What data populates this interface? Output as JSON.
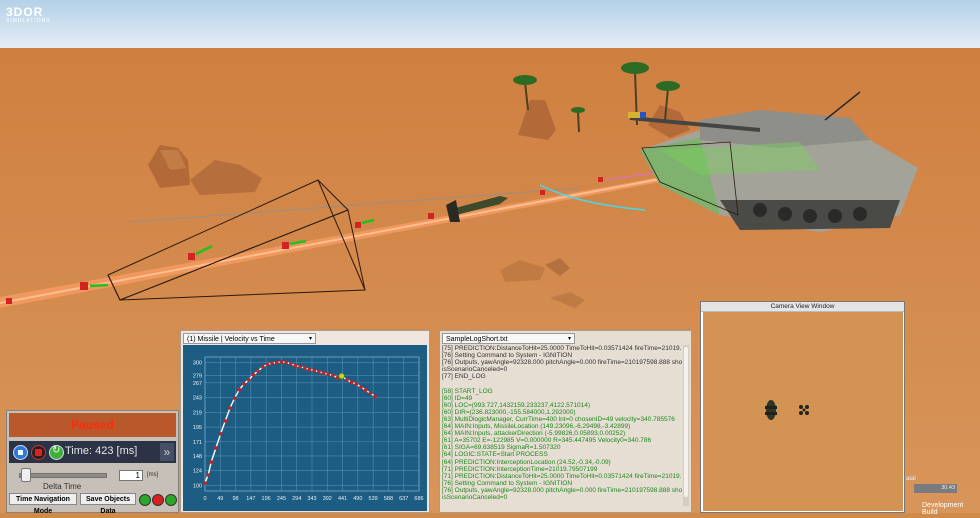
{
  "logo": {
    "name": "3DOR",
    "subtitle": "SIMULATIONS"
  },
  "playback": {
    "status": "Paused",
    "time_text": "Time: 423 [ms]",
    "fast_forward": "»",
    "delta_label": "Delta Time",
    "delta_value": "1",
    "delta_unit": "[ms]",
    "slider_fraction": 0.02,
    "time_nav_label": "Time Navigation Mode",
    "save_label": "Save Objects Data"
  },
  "graph": {
    "dropdown": "(1) Missile | Velocity vs Time",
    "dropdown_arrow": "▾"
  },
  "chart_data": {
    "type": "scatter",
    "title": "",
    "xlabel": "",
    "ylabel": "",
    "x_ticks": [
      0,
      49,
      98,
      147,
      196,
      245,
      294,
      343,
      392,
      441,
      490,
      539,
      588,
      637,
      686
    ],
    "y_ticks": [
      100,
      124,
      148,
      171,
      195,
      219,
      243,
      267,
      279,
      300
    ],
    "xlim": [
      0,
      686
    ],
    "ylim": [
      91,
      309
    ],
    "series": [
      {
        "color": "#c82020",
        "points": [
          [
            0,
            104
          ],
          [
            10,
            117
          ],
          [
            20,
            138
          ],
          [
            35,
            161
          ],
          [
            50,
            184
          ],
          [
            65,
            205
          ],
          [
            80,
            226
          ],
          [
            95,
            242
          ],
          [
            110,
            256
          ],
          [
            125,
            265
          ],
          [
            140,
            272
          ],
          [
            155,
            280
          ],
          [
            170,
            286
          ],
          [
            185,
            293
          ],
          [
            200,
            297
          ],
          [
            215,
            299
          ],
          [
            230,
            300
          ],
          [
            245,
            301
          ],
          [
            260,
            300
          ],
          [
            275,
            298
          ],
          [
            290,
            295
          ],
          [
            305,
            293
          ],
          [
            320,
            291
          ],
          [
            335,
            289
          ],
          [
            350,
            287
          ],
          [
            365,
            285
          ],
          [
            380,
            283
          ],
          [
            395,
            281
          ],
          [
            410,
            279
          ],
          [
            425,
            275
          ],
          [
            440,
            277
          ],
          [
            455,
            272
          ],
          [
            470,
            268
          ],
          [
            485,
            265
          ],
          [
            500,
            260
          ],
          [
            515,
            255
          ],
          [
            530,
            250
          ],
          [
            545,
            245
          ]
        ]
      }
    ],
    "highlight_point": [
      438,
      278
    ],
    "curve_color": "#ffffff",
    "grid": true
  },
  "log": {
    "dropdown": "SampleLogShort.txt",
    "dropdown_arrow": "▾",
    "lines": [
      {
        "t": "[75] PREDICTION:DistanceToHit=25.0000 TimeToHit=0.03571424 fireTime=21019.7592",
        "c": "#333"
      },
      {
        "t": "[76] Setting Command to System - IGNITION",
        "c": "#333"
      },
      {
        "t": "[76] Outputs, yawAngle=92328.000 pitchAngle=0.000 fireTime=210197598.888 shouldA",
        "c": "#333"
      },
      {
        "t": "isScenarioCanceled=0",
        "c": "#333"
      },
      {
        "t": "[77] END_LOG",
        "c": "#333"
      },
      {
        "t": "",
        "c": "#333"
      },
      {
        "t": "[58] START_LOG",
        "c": "#1e8a1e"
      },
      {
        "t": "[60] ID=49",
        "c": "#1e8a1e"
      },
      {
        "t": "[60] LOC=(993.727,1432159.233237,4122.571014)",
        "c": "#1e8a1e"
      },
      {
        "t": "[60] DIR=(236.823000,-155.584000,1.292000)",
        "c": "#1e8a1e"
      },
      {
        "t": "[63] MultiDlogicManager, CurrTime=400 lnt=0 chosenID=49 velocity=340.785576",
        "c": "#1e8a1e"
      },
      {
        "t": "[64] MAIN:Inputs, MissileLocation (149.23096,-6.29498,-3.42899)",
        "c": "#1e8a1e"
      },
      {
        "t": "[64] MAIN:Inputs, attackerDirection (-5.99826,0.05893,0.00252)",
        "c": "#1e8a1e"
      },
      {
        "t": "[61] A=35702 E=-122985 V=0.000000 R=345.447495 Velocity0=340.786",
        "c": "#1e8a1e"
      },
      {
        "t": "[61] SIGA=69.638519 SigmaR=1.507320",
        "c": "#1e8a1e"
      },
      {
        "t": "[64] LOGIC:STATE=Start PROCESS",
        "c": "#1e8a1e"
      },
      {
        "t": "[64] PREDICTION:InterceptionLocation (24.52,-0.34,-0.09)",
        "c": "#1e8a1e"
      },
      {
        "t": "[71] PREDICTION:InterceptionTime=21019.79507199",
        "c": "#1e8a1e"
      },
      {
        "t": "[71] PREDICTION:DistanceToHit=25.0000 TimeToHit=0.03571424 fireTime=21019.7592",
        "c": "#1e8a1e"
      },
      {
        "t": "[76] Setting Command to System - IGNITION",
        "c": "#1e8a1e"
      },
      {
        "t": "[76] Outputs, yawAngle=92328.000 pitchAngle=0.000 fireTime=210197598.888 shouldA",
        "c": "#1e8a1e"
      },
      {
        "t": "isScenarioCanceled=0",
        "c": "#1e8a1e"
      }
    ]
  },
  "camera": {
    "title": "Camera View Window"
  },
  "right_panel": {
    "label": "atal",
    "value": "30.43"
  },
  "dev_build": "Development Build",
  "colors": {
    "desert": "#d08a4a",
    "sky_top": "#b9d4ea",
    "sky_bottom": "#e4eef6",
    "paused": "#ff2a10",
    "graph_bg": "#1d5d83"
  }
}
